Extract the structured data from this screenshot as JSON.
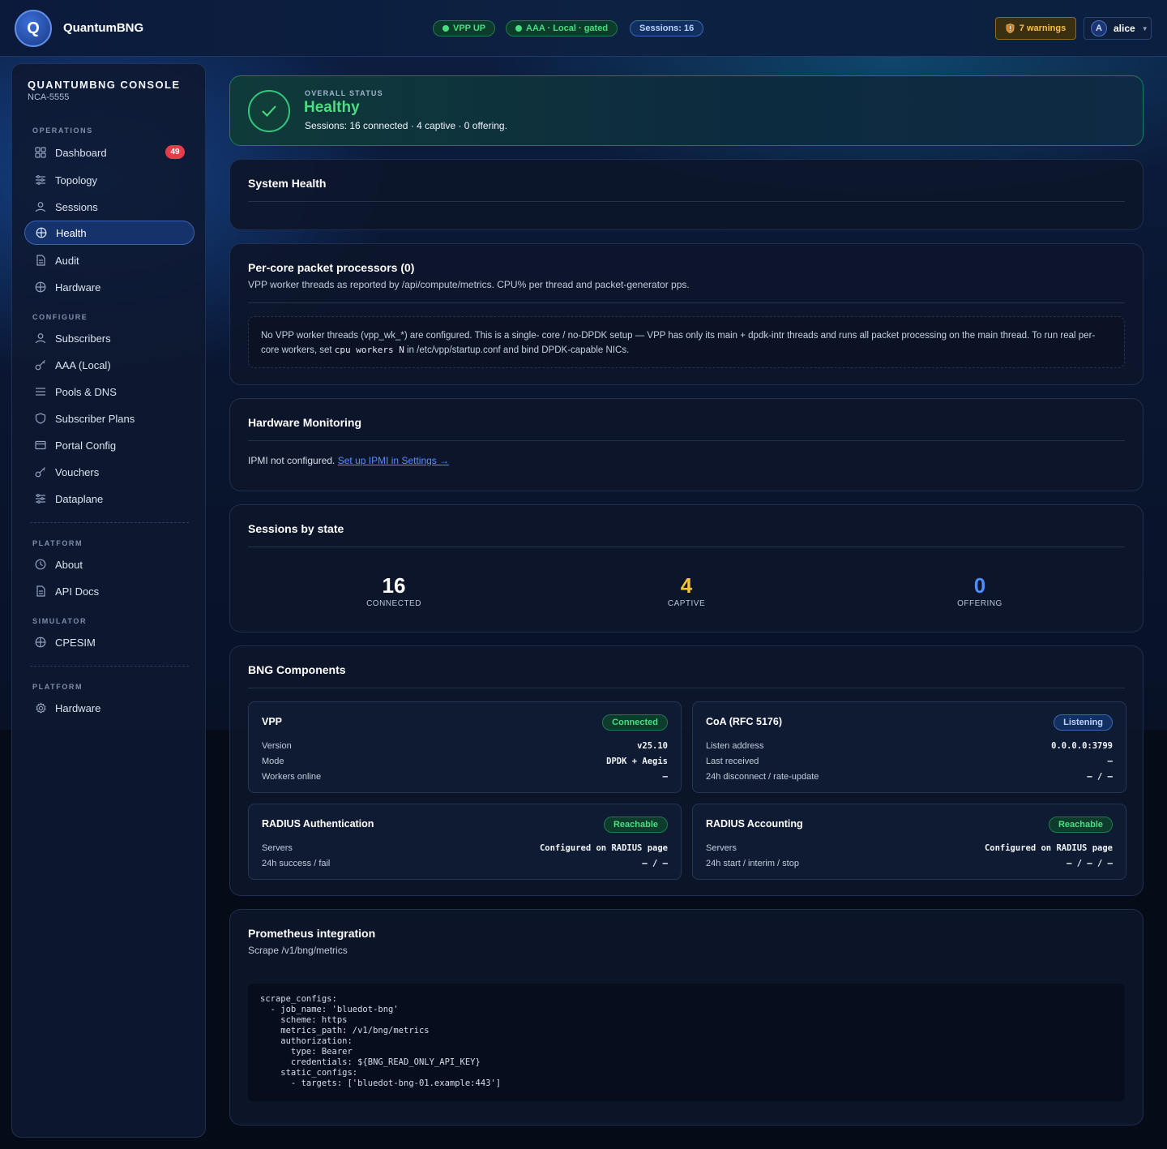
{
  "topbar": {
    "logo_letter": "Q",
    "brand": "QuantumBNG",
    "pills": {
      "vpp": "VPP UP",
      "aaa": "AAA · Local · gated",
      "sessions": "Sessions: 16"
    },
    "warnings": "7 warnings",
    "user": {
      "initial": "A",
      "name": "alice"
    }
  },
  "sidebar": {
    "title": "QUANTUMBNG CONSOLE",
    "subtitle": "NCA-5555",
    "sections": {
      "operations": "OPERATIONS",
      "configure": "CONFIGURE",
      "platform": "PLATFORM",
      "simulator": "SIMULATOR",
      "platform2": "PLATFORM"
    },
    "items": {
      "dashboard": "Dashboard",
      "dashboard_badge": "49",
      "topology": "Topology",
      "sessions": "Sessions",
      "health": "Health",
      "audit": "Audit",
      "hardware": "Hardware",
      "subscribers": "Subscribers",
      "aaa": "AAA (Local)",
      "pools": "Pools & DNS",
      "plans": "Subscriber Plans",
      "portal": "Portal Config",
      "vouchers": "Vouchers",
      "dataplane": "Dataplane",
      "about": "About",
      "api_docs": "API Docs",
      "cpesim": "CPESIM",
      "hardware2": "Hardware"
    }
  },
  "status": {
    "kicker": "OVERALL STATUS",
    "state": "Healthy",
    "line": "Sessions: 16 connected · 4 captive · 0 offering."
  },
  "system_health": {
    "title": "System Health"
  },
  "per_core": {
    "title": "Per-core packet processors (0)",
    "subtitle": "VPP worker threads as reported by /api/compute/metrics. CPU% per thread and packet-generator pps.",
    "note_a": "No VPP worker threads (vpp_wk_*) are configured. This is a single- core / no-DPDK setup — VPP has only its main + dpdk-intr threads and runs all packet processing on the main thread. To run real per-core workers, set ",
    "note_code": "cpu workers N",
    "note_b": " in /etc/vpp/startup.conf and bind DPDK-capable NICs."
  },
  "hardware_monitoring": {
    "title": "Hardware Monitoring",
    "text": "IPMI not configured. ",
    "link": "Set up IPMI in Settings →"
  },
  "sessions_by_state": {
    "title": "Sessions by state",
    "connected_value": "16",
    "connected_label": "CONNECTED",
    "captive_value": "4",
    "captive_label": "CAPTIVE",
    "offering_value": "0",
    "offering_label": "OFFERING",
    "colors": {
      "connected": "#ffffff",
      "captive": "#f5c531",
      "offering": "#4d8dff"
    }
  },
  "bng_components": {
    "title": "BNG Components",
    "vpp": {
      "title": "VPP",
      "status": "Connected",
      "version_k": "Version",
      "version_v": "v25.10",
      "mode_k": "Mode",
      "mode_v": "DPDK + Aegis",
      "workers_k": "Workers online",
      "workers_v": "—"
    },
    "coa": {
      "title": "CoA (RFC 5176)",
      "status": "Listening",
      "listen_k": "Listen address",
      "listen_v": "0.0.0.0:3799",
      "last_k": "Last received",
      "last_v": "—",
      "disc_k": "24h disconnect / rate-update",
      "disc_v": "— / —"
    },
    "radius_auth": {
      "title": "RADIUS Authentication",
      "status": "Reachable",
      "servers_k": "Servers",
      "servers_v": "Configured on RADIUS page",
      "succ_k": "24h success / fail",
      "succ_v": "— / —"
    },
    "radius_acct": {
      "title": "RADIUS Accounting",
      "status": "Reachable",
      "servers_k": "Servers",
      "servers_v": "Configured on RADIUS page",
      "start_k": "24h start / interim / stop",
      "start_v": "— / — / —"
    }
  },
  "prometheus": {
    "title": "Prometheus integration",
    "subtitle": "Scrape /v1/bng/metrics",
    "code": "scrape_configs:\n  - job_name: 'bluedot-bng'\n    scheme: https\n    metrics_path: /v1/bng/metrics\n    authorization:\n      type: Bearer\n      credentials: ${BNG_READ_ONLY_API_KEY}\n    static_configs:\n      - targets: ['bluedot-bng-01.example:443']"
  }
}
